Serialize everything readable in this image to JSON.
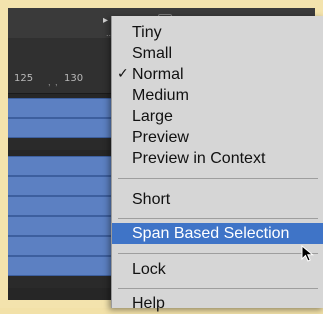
{
  "ruler": {
    "tick_label_a": "125",
    "tick_label_b": "130"
  },
  "menu": {
    "items": [
      {
        "label": "Tiny",
        "checked": false
      },
      {
        "label": "Small",
        "checked": false
      },
      {
        "label": "Normal",
        "checked": true
      },
      {
        "label": "Medium",
        "checked": false
      },
      {
        "label": "Large",
        "checked": false
      },
      {
        "label": "Preview",
        "checked": false
      },
      {
        "label": "Preview in Context",
        "checked": false
      },
      {
        "label": "Short",
        "checked": false
      },
      {
        "label": "Span Based Selection",
        "checked": false,
        "highlighted": true
      },
      {
        "label": "Lock",
        "checked": false
      },
      {
        "label": "Help",
        "checked": false
      }
    ],
    "checkmark": "✓"
  },
  "colors": {
    "highlight": "#3f74c7",
    "clip": "#5c80c2",
    "menu_bg": "#d6d6d6"
  }
}
